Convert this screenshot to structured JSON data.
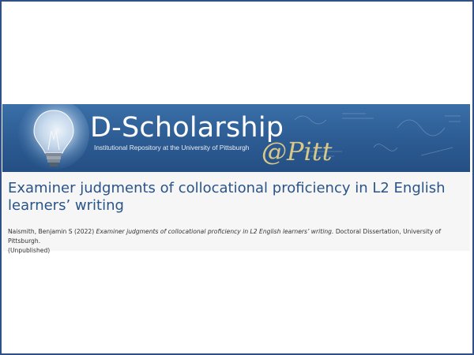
{
  "banner": {
    "site_name": "D-Scholarship",
    "tagline": "Institutional Repository at the University of Pittsburgh",
    "pitt_mark": "@Pitt"
  },
  "record": {
    "title": "Examiner judgments of collocational proficiency in L2 English learners’ writing",
    "citation": {
      "authors_year": "Naismith, Benjamin S (2022)",
      "work_title": "Examiner judgments of collocational proficiency in L2 English learners’ writing.",
      "details": "Doctoral Dissertation, University of Pittsburgh.",
      "status": "(Unpublished)"
    }
  },
  "colors": {
    "frame_border": "#2f4f86",
    "banner_blue": "#2c5b92",
    "title_blue": "#2a5488",
    "pitt_gold": "#d9c989"
  },
  "icons": {
    "banner_icon": "light-bulb-icon"
  }
}
